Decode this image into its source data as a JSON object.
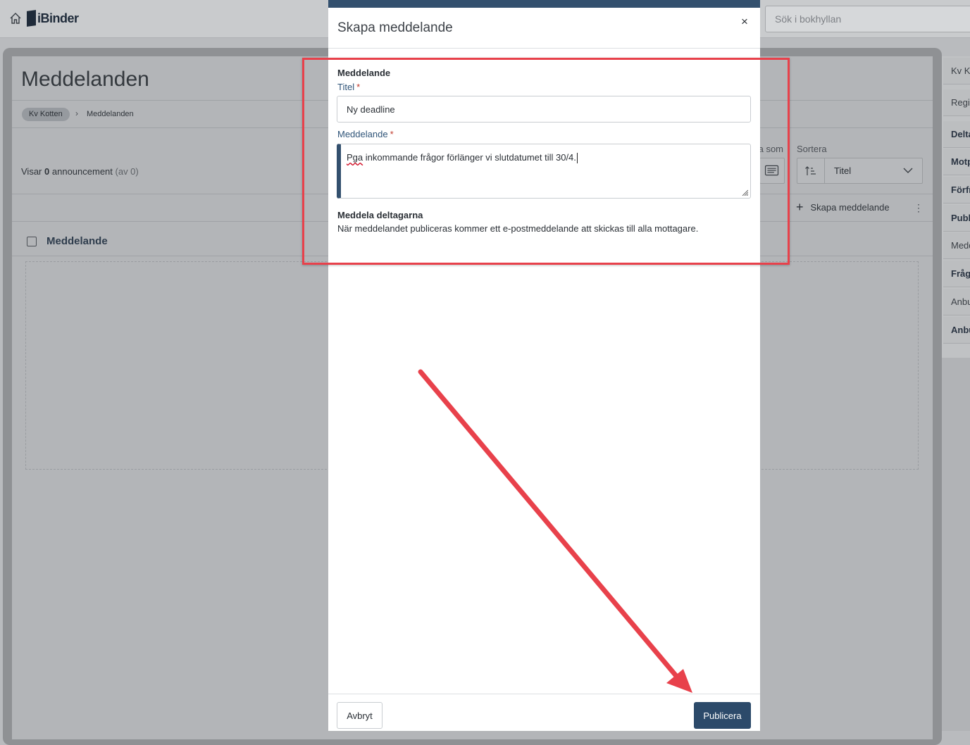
{
  "app": {
    "logo_text": "iBinder",
    "search_placeholder": "Sök i bokhyllan"
  },
  "page": {
    "title": "Meddelanden",
    "breadcrumb": [
      "Kv Kotten",
      "Meddelanden"
    ],
    "count_prefix": "Visar",
    "count_value": "0",
    "count_noun": "announcement",
    "count_total": "(av 0)",
    "show_as_label": "ta som",
    "sort_label": "Sortera",
    "sort_value": "Titel",
    "create_label": "Skapa meddelande",
    "column_header": "Meddelande"
  },
  "right_sidebar": {
    "items": [
      {
        "label": "Kv Ko",
        "bold": false
      },
      {
        "label": "Regis",
        "bold": false
      },
      {
        "label": "Delta",
        "bold": true
      },
      {
        "label": "Motp",
        "bold": true
      },
      {
        "label": "Förfr",
        "bold": true
      },
      {
        "label": "Publ",
        "bold": true
      },
      {
        "label": "Medd",
        "bold": false
      },
      {
        "label": "Fråg",
        "bold": true
      },
      {
        "label": "Anbu",
        "bold": false
      },
      {
        "label": "Anbu",
        "bold": true
      }
    ]
  },
  "modal": {
    "title": "Skapa meddelande",
    "close_symbol": "×",
    "section_title": "Meddelande",
    "title_label": "Titel",
    "title_value": "Ny deadline",
    "message_label": "Meddelande",
    "required_mark": "*",
    "message_misspelled": "Pga",
    "message_rest": " inkommande frågor förlänger vi slutdatumet till 30/4.",
    "notify_title": "Meddela deltagarna",
    "notify_text": "När meddelandet publiceras kommer ett e-postmeddelande att skickas till alla mottagare.",
    "cancel_label": "Avbryt",
    "publish_label": "Publicera"
  },
  "colors": {
    "modal_accent": "#33506e",
    "publish_button": "#2c4a6a",
    "annotation_red": "#e8414b",
    "required_red": "#c0392b"
  },
  "icons": [
    "home-icon",
    "logo-icon",
    "chevron-right-icon",
    "list-view-icon",
    "sort-ascending-icon",
    "chevron-down-icon",
    "plus-icon",
    "kebab-menu-icon",
    "close-icon",
    "resize-grip-icon"
  ]
}
